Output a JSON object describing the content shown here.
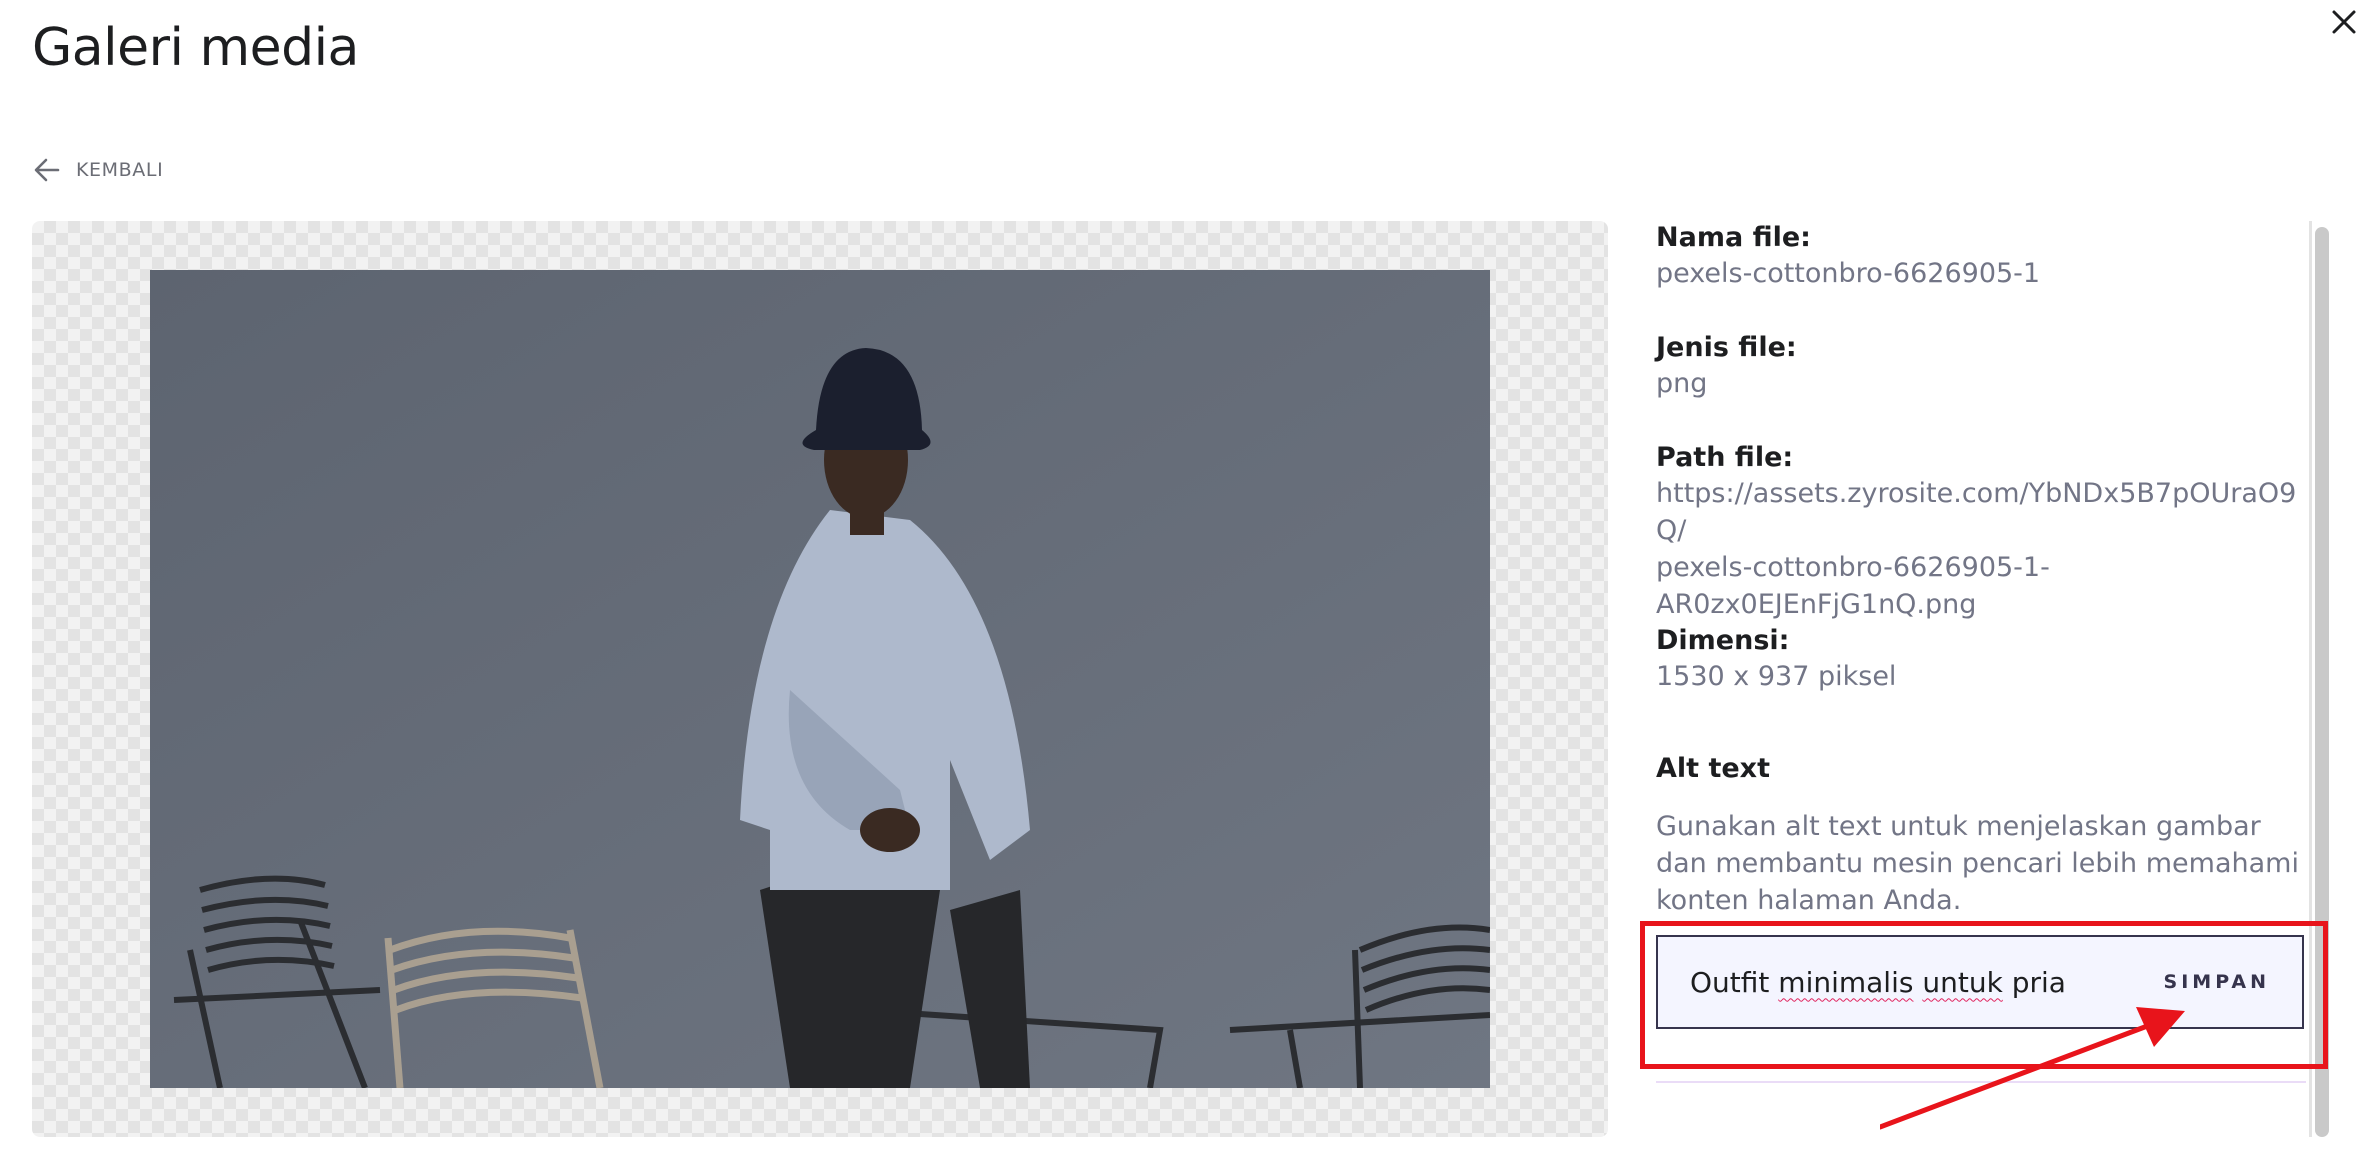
{
  "header": {
    "title": "Galeri media",
    "back_label": "KEMBALI"
  },
  "details": {
    "file_name_label": "Nama file:",
    "file_name_value": "pexels-cottonbro-6626905-1",
    "file_type_label": "Jenis file:",
    "file_type_value": "png",
    "path_label": "Path file:",
    "path_line1": "https://assets.zyrosite.com/YbNDx5B7pOUraO9Q/",
    "path_line2": "pexels-cottonbro-6626905-1-",
    "path_line3": "AR0zx0EJEnFjG1nQ.png",
    "dimension_label": "Dimensi:",
    "dimension_value": "1530 x 937 piksel",
    "alt_label": "Alt text",
    "alt_description": "Gunakan alt text untuk menjelaskan gambar dan membantu mesin pencari lebih memahami konten halaman Anda.",
    "alt_words": [
      "Outfit",
      "minimalis",
      "untuk",
      "pria"
    ],
    "save_label": "SIMPAN"
  },
  "icons": {
    "close": "close-icon",
    "back": "arrow-left-icon"
  },
  "colors": {
    "annotation_red": "#e8141b",
    "input_bg": "#f4f5ff",
    "text_muted": "#727586"
  }
}
